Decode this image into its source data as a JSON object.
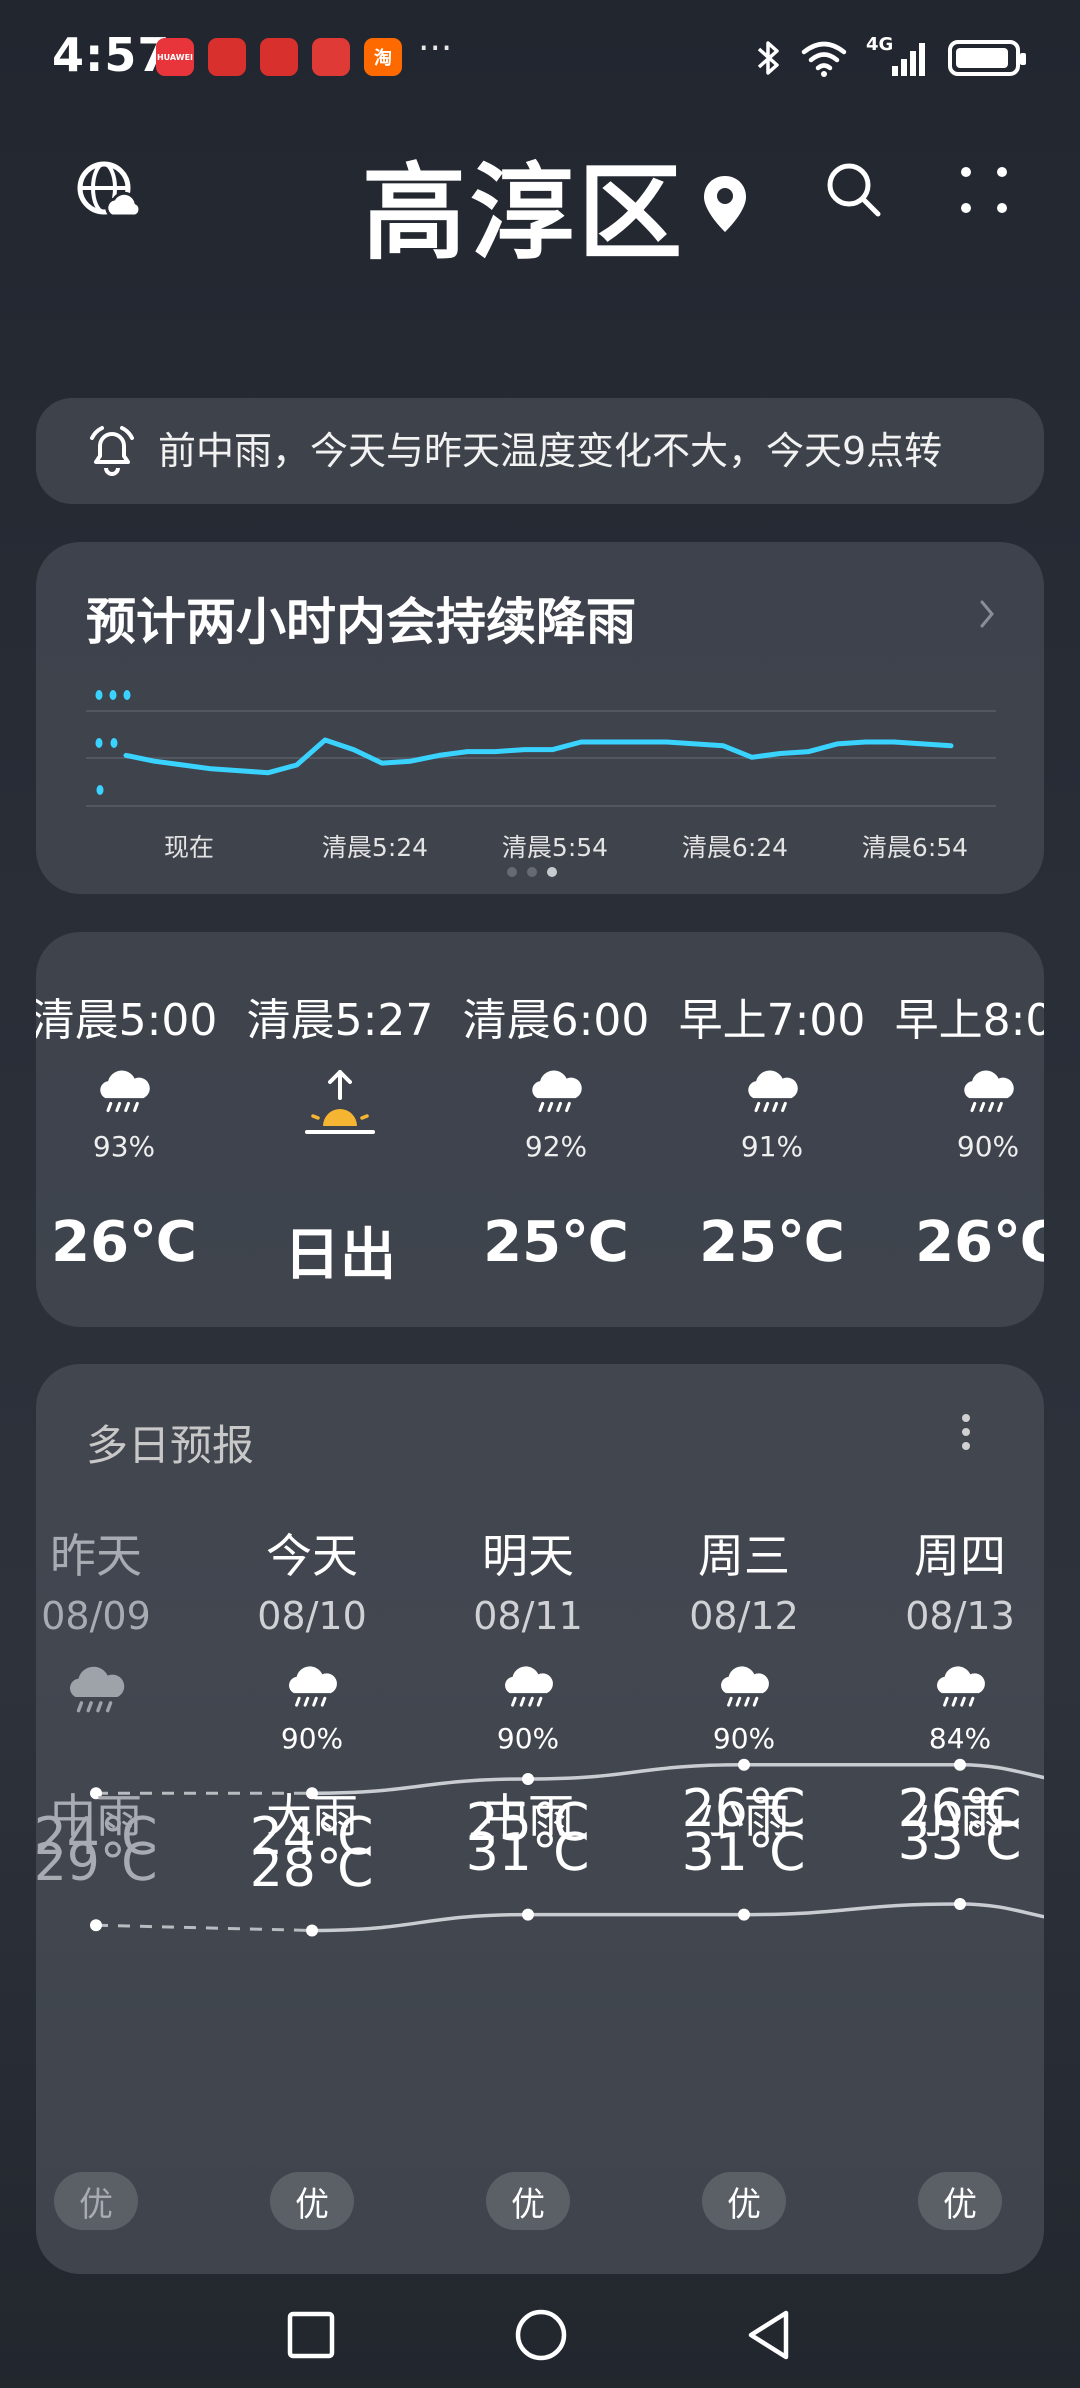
{
  "status_bar": {
    "time": "4:57",
    "apps": [
      {
        "name": "huawei-app-icon",
        "label": "HUAWEI",
        "color": "#e8343b"
      },
      {
        "name": "pig-app-icon",
        "label": "",
        "color": "#d8302c"
      },
      {
        "name": "pig-app-icon-2",
        "label": "",
        "color": "#d8302c"
      },
      {
        "name": "book-app-icon",
        "label": "",
        "color": "#e03a36"
      },
      {
        "name": "taobao-app-icon",
        "label": "淘",
        "color": "#ff6a00"
      }
    ],
    "more": "···",
    "network": "4G"
  },
  "header": {
    "city": "高淳区"
  },
  "alert": {
    "text": "前中雨，今天与昨天温度变化不大，今天9点转"
  },
  "rain": {
    "title": "预计两小时内会持续降雨",
    "ticks": [
      "现在",
      "清晨5:24",
      "清晨5:54",
      "清晨6:24",
      "清晨6:54"
    ],
    "series": [
      0.55,
      0.52,
      0.5,
      0.48,
      0.47,
      0.46,
      0.5,
      0.63,
      0.58,
      0.51,
      0.52,
      0.55,
      0.57,
      0.57,
      0.58,
      0.58,
      0.62,
      0.62,
      0.62,
      0.62,
      0.61,
      0.6,
      0.54,
      0.56,
      0.57,
      0.61,
      0.62,
      0.62,
      0.61,
      0.6
    ],
    "accent": "#3ad3ff"
  },
  "hourly": [
    {
      "time": "清晨5:00",
      "pct": "93%",
      "temp": "26℃",
      "icon": "rain"
    },
    {
      "time": "清晨5:27",
      "pct": "",
      "temp": "日出",
      "icon": "sunrise"
    },
    {
      "time": "清晨6:00",
      "pct": "92%",
      "temp": "25℃",
      "icon": "rain"
    },
    {
      "time": "早上7:00",
      "pct": "91%",
      "temp": "25℃",
      "icon": "rain"
    },
    {
      "time": "早上8:00",
      "pct": "90%",
      "temp": "26℃",
      "icon": "rain"
    }
  ],
  "daily": {
    "title": "多日预报",
    "days": [
      {
        "name": "昨天",
        "date": "08/09",
        "pct": "",
        "cond": "中雨",
        "hi": "29℃",
        "lo": "24℃",
        "aqi": "优",
        "hi_val": 29,
        "lo_val": 24,
        "past": true
      },
      {
        "name": "今天",
        "date": "08/10",
        "pct": "90%",
        "cond": "大雨",
        "hi": "28℃",
        "lo": "24℃",
        "aqi": "优",
        "hi_val": 28,
        "lo_val": 24,
        "past": false
      },
      {
        "name": "明天",
        "date": "08/11",
        "pct": "90%",
        "cond": "中雨",
        "hi": "31℃",
        "lo": "25℃",
        "aqi": "优",
        "hi_val": 31,
        "lo_val": 25,
        "past": false
      },
      {
        "name": "周三",
        "date": "08/12",
        "pct": "90%",
        "cond": "小雨",
        "hi": "31℃",
        "lo": "26℃",
        "aqi": "优",
        "hi_val": 31,
        "lo_val": 26,
        "past": false
      },
      {
        "name": "周四",
        "date": "08/13",
        "pct": "84%",
        "cond": "小雨",
        "hi": "33℃",
        "lo": "26℃",
        "aqi": "优",
        "hi_val": 33,
        "lo_val": 26,
        "past": false
      }
    ]
  }
}
